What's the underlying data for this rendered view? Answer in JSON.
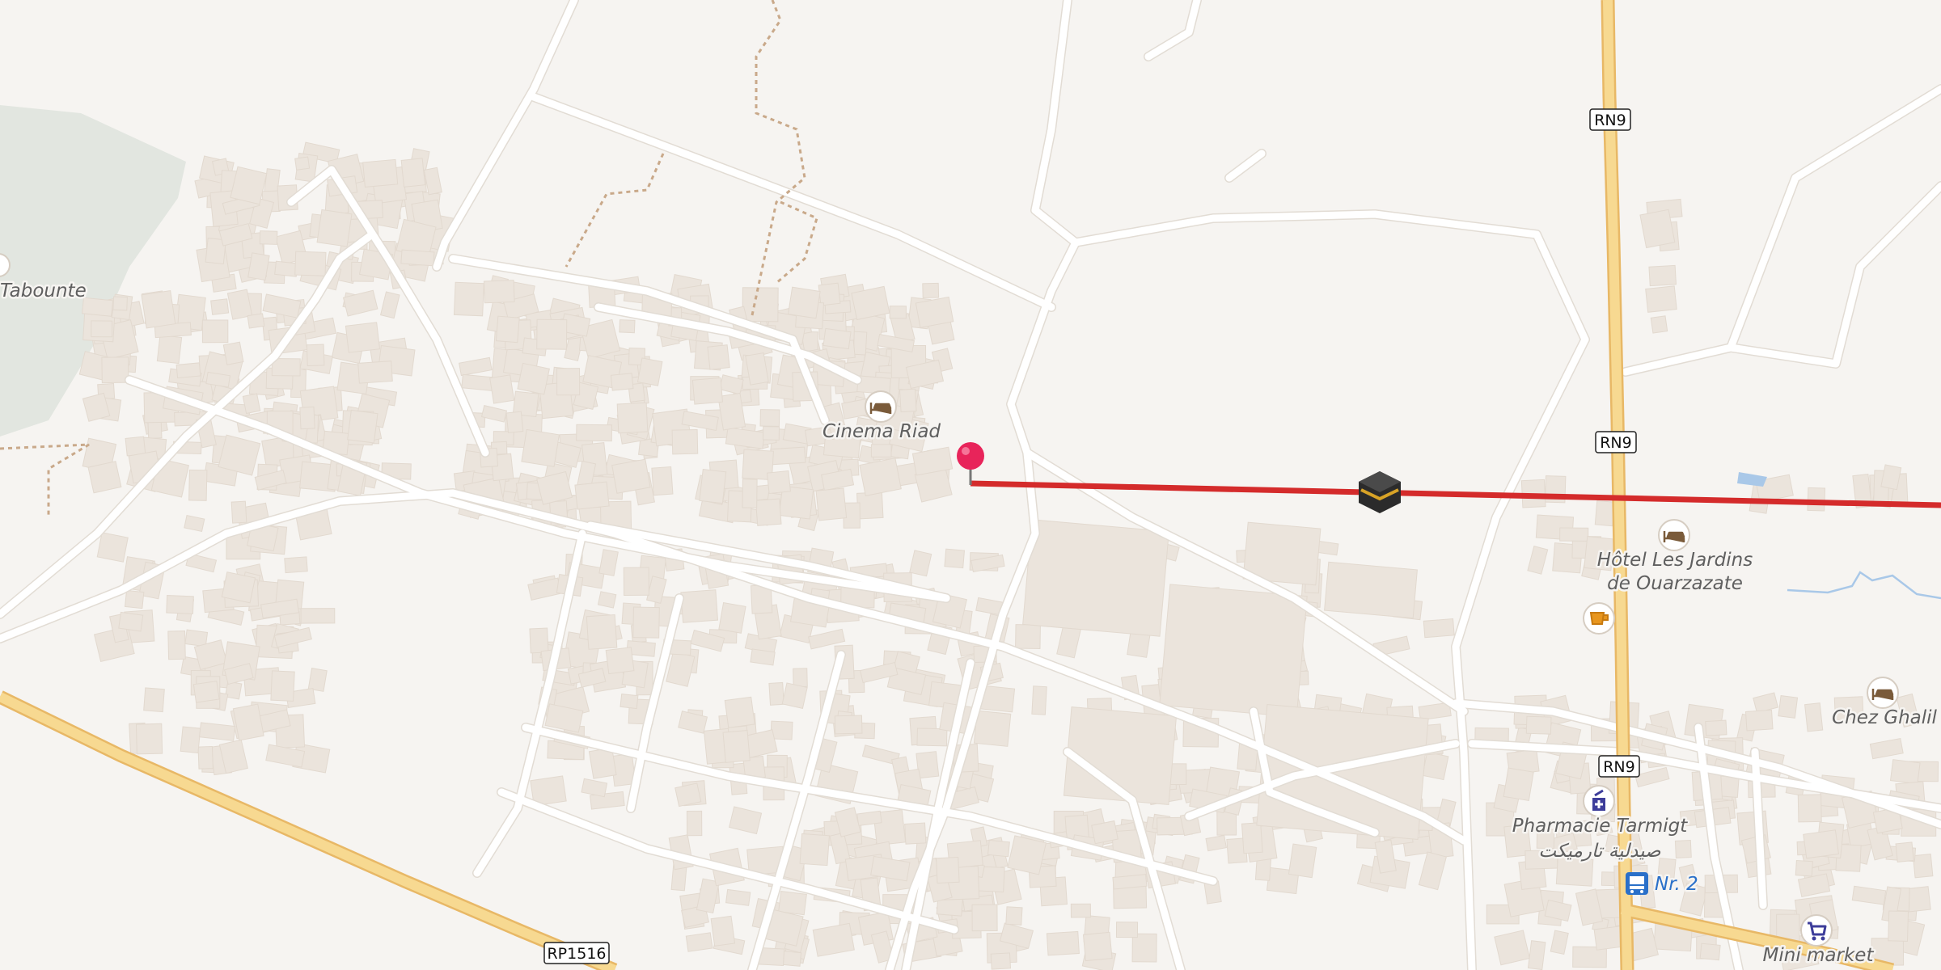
{
  "map": {
    "labels": {
      "cinema": "Cinema Riad",
      "taboute": "Tabounte",
      "hotel_line1": "Hôtel Les Jardins",
      "hotel_line2": "de Ouarzazate",
      "chez": "Chez Ghalil",
      "pharmacie_fr": "Pharmacie Tarmigt",
      "pharmacie_ar": "صيدلية تارميكت",
      "bus_stop": "Nr. 2",
      "minimarket": "Mini market"
    },
    "road_shields": {
      "rn9_top": "RN9",
      "rn9_mid": "RN9",
      "rn9_low": "RN9",
      "rp1516": "RP1516"
    },
    "icons": {
      "hotel": "bed-icon",
      "cafe": "cup-icon",
      "pharmacy": "pharmacy-icon",
      "bus": "bus-icon",
      "shop": "cart-icon",
      "pin": "location-pin-icon",
      "qibla": "kaaba-icon"
    },
    "colors": {
      "background": "#f6f4f1",
      "building": "#ebe4dc",
      "road": "#ffffff",
      "primary_road": "#f7d991",
      "primary_road_casing": "#e8b866",
      "park": "#e2e6e0",
      "direction_line": "#d42b2b",
      "pin": "#e8245a",
      "poi_icon": "#7a5b3a",
      "bus_blue": "#2a70c9",
      "shop_purple": "#3d3d9a"
    }
  }
}
